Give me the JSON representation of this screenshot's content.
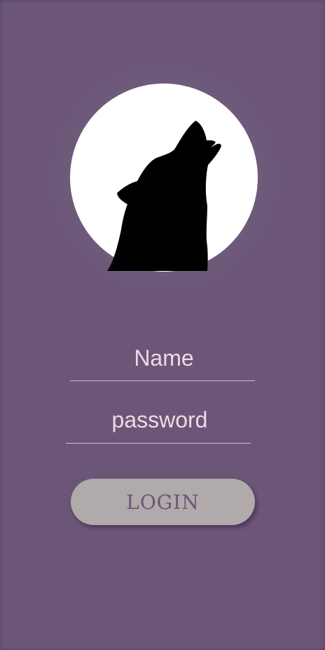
{
  "logo": {
    "icon": "wolf-howling-moon-icon",
    "moon_color": "#ffffff",
    "wolf_color": "#000000"
  },
  "form": {
    "name_placeholder": "Name",
    "password_placeholder": "password",
    "login_label": "LOGIN"
  },
  "colors": {
    "background": "#6b5677",
    "text": "#f3d6e6",
    "button": "#b0aaab",
    "button_text": "#6b5677"
  }
}
